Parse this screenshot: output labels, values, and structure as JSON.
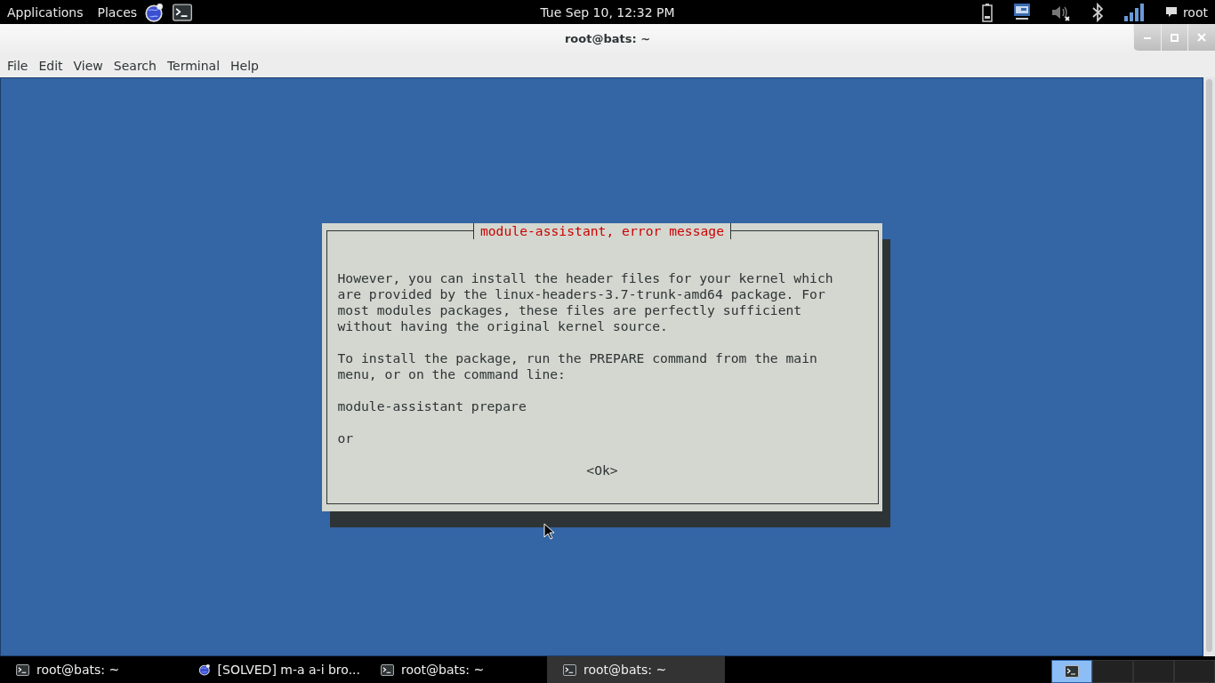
{
  "top_panel": {
    "menus": [
      "Applications",
      "Places"
    ],
    "clock": "Tue Sep 10, 12:32 PM",
    "user": "root"
  },
  "window": {
    "title": "root@bats: ~"
  },
  "menu_bar": [
    "File",
    "Edit",
    "View",
    "Search",
    "Terminal",
    "Help"
  ],
  "dialog": {
    "title": "module-assistant, error message",
    "paragraphs": [
      "However, you can install the header files for your kernel which\nare provided by the linux-headers-3.7-trunk-amd64 package. For\nmost modules packages, these files are perfectly sufficient\nwithout having the original kernel source.",
      "To install the package, run the PREPARE command from the main\nmenu, or on the command line:",
      "module-assistant prepare",
      "or"
    ],
    "button": "<Ok>"
  },
  "taskbar": {
    "tasks": [
      {
        "label": "root@bats: ~",
        "kind": "terminal",
        "selected": false
      },
      {
        "label": "[SOLVED] m-a a-i bro...",
        "kind": "browser",
        "selected": false
      },
      {
        "label": "root@bats: ~",
        "kind": "terminal",
        "selected": false
      },
      {
        "label": "root@bats: ~",
        "kind": "terminal",
        "selected": true
      }
    ],
    "workspaces": [
      {
        "selected": true
      },
      {
        "selected": false
      },
      {
        "selected": false
      },
      {
        "selected": false
      }
    ]
  }
}
